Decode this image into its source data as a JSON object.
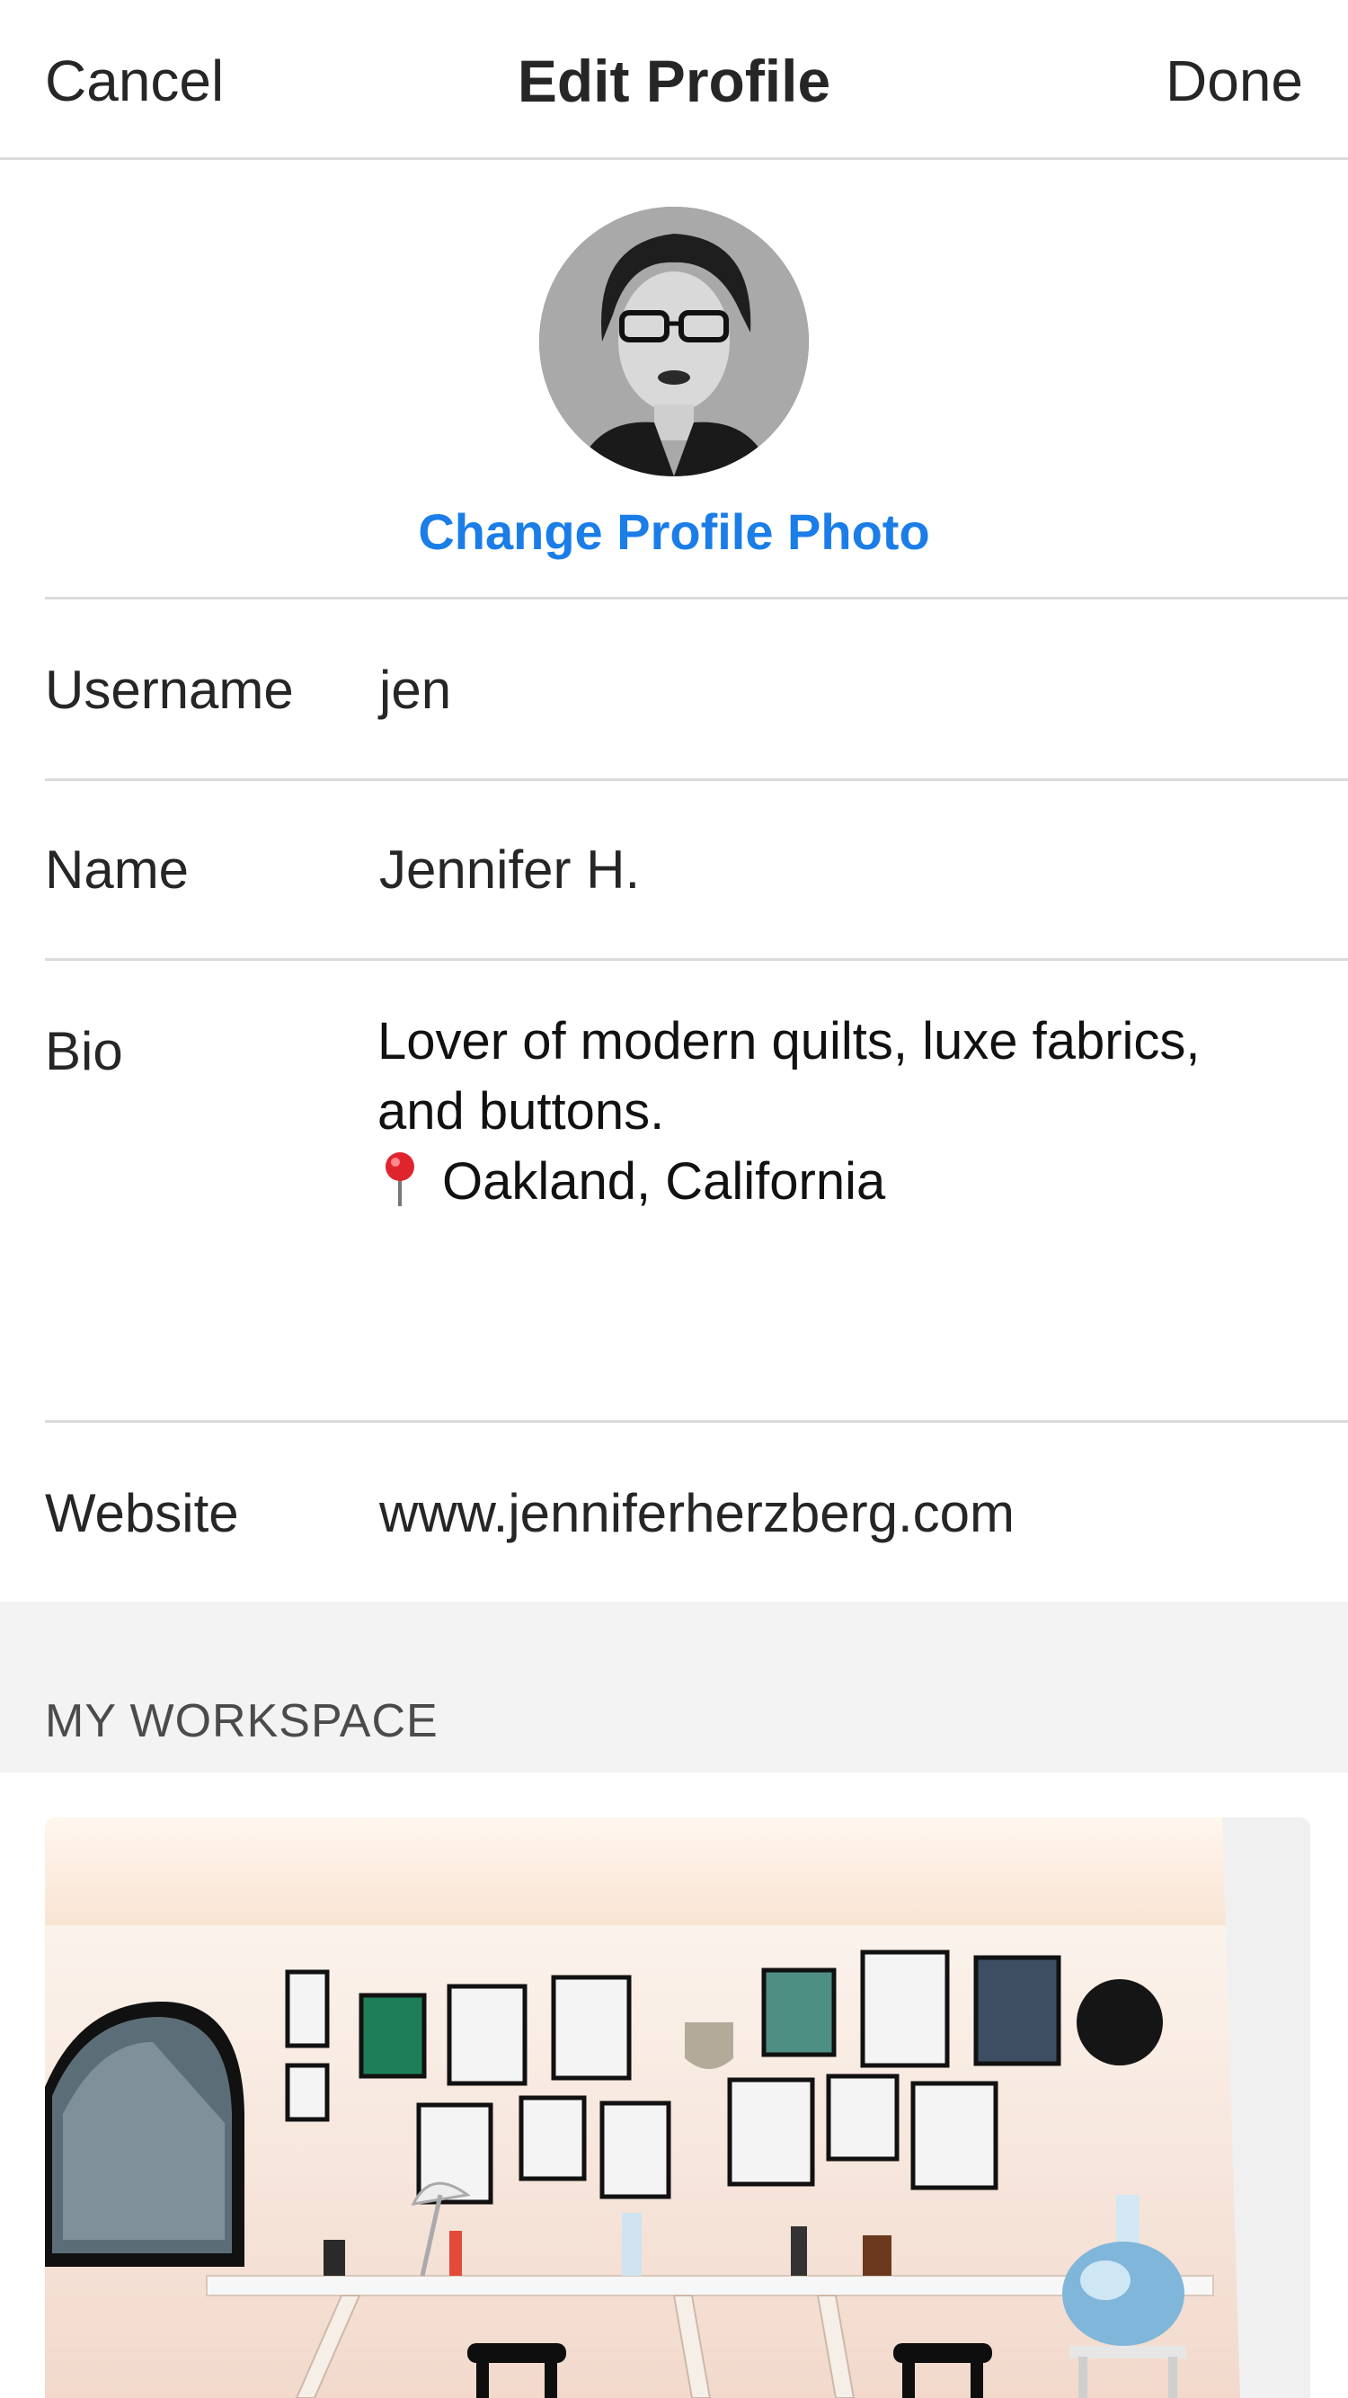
{
  "navbar": {
    "cancel_label": "Cancel",
    "title": "Edit Profile",
    "done_label": "Done"
  },
  "profile_photo": {
    "change_label": "Change Profile Photo"
  },
  "fields": {
    "username": {
      "label": "Username",
      "value": "jen"
    },
    "name": {
      "label": "Name",
      "value": "Jennifer H."
    },
    "bio": {
      "label": "Bio",
      "line1": "Lover of modern quilts, luxe fabrics,",
      "line2": "and buttons.",
      "line3": "Oakland, California",
      "line3_icon": "location-pin-icon"
    },
    "website": {
      "label": "Website",
      "value": "www.jenniferherzberg.com"
    }
  },
  "section": {
    "title": "MY WORKSPACE"
  },
  "colors": {
    "accent": "#1a7de8",
    "text": "#262626",
    "divider": "#dbdbdb",
    "section_bg": "#f3f3f3"
  }
}
